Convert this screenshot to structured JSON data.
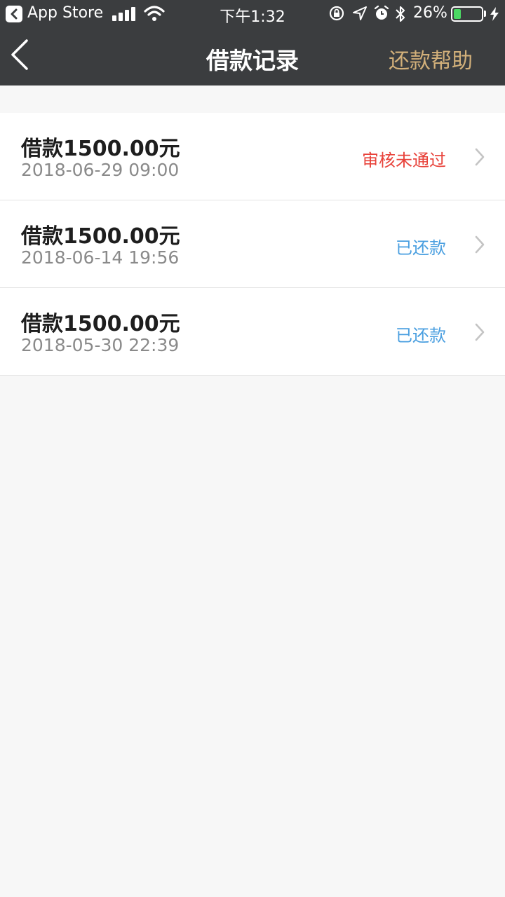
{
  "status_bar": {
    "back_app": "App Store",
    "time": "下午1:32",
    "battery_percent": "26%",
    "battery_level": 0.26,
    "icons": [
      "signal-icon",
      "wifi-icon",
      "rotation-lock-icon",
      "location-icon",
      "alarm-icon",
      "bluetooth-icon",
      "battery-icon",
      "charging-bolt-icon"
    ]
  },
  "nav": {
    "title": "借款记录",
    "help_label": "还款帮助",
    "help_color": "#d2b07a"
  },
  "records": [
    {
      "title": "借款1500.00元",
      "date": "2018-06-29 09:00",
      "status": "审核未通过",
      "status_color": "#e8423a"
    },
    {
      "title": "借款1500.00元",
      "date": "2018-06-14 19:56",
      "status": "已还款",
      "status_color": "#4a9fe0"
    },
    {
      "title": "借款1500.00元",
      "date": "2018-05-30 22:39",
      "status": "已还款",
      "status_color": "#4a9fe0"
    }
  ]
}
